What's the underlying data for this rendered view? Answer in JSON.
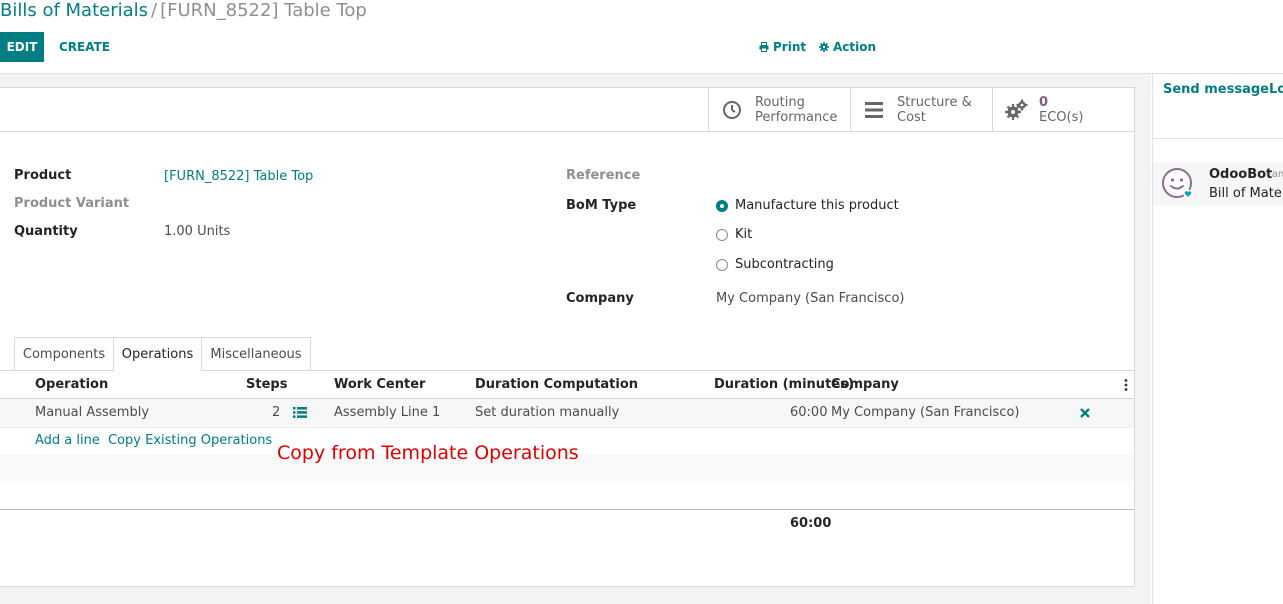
{
  "breadcrumb": {
    "parent": "Bills of Materials",
    "separator": "/",
    "current": "[FURN_8522] Table Top"
  },
  "toolbar": {
    "edit_label": "EDIT",
    "create_label": "CREATE",
    "print_label": "Print",
    "action_label": "Action"
  },
  "smart_buttons": {
    "routing": {
      "line1": "Routing",
      "line2": "Performance",
      "icon": "clock-icon"
    },
    "structure": {
      "line1": "Structure &",
      "line2": "Cost",
      "icon": "bars-icon"
    },
    "eco": {
      "count": "0",
      "label": "ECO(s)",
      "icon": "gears-icon"
    }
  },
  "form": {
    "product_label": "Product",
    "product_value": "[FURN_8522] Table Top",
    "variant_label": "Product Variant",
    "quantity_label": "Quantity",
    "quantity_value": "1.00",
    "quantity_uom": "Units",
    "reference_label": "Reference",
    "bom_type_label": "BoM Type",
    "bom_types": [
      "Manufacture this product",
      "Kit",
      "Subcontracting"
    ],
    "bom_type_selected": "Manufacture this product",
    "company_label": "Company",
    "company_value": "My Company (San Francisco)"
  },
  "tabs": [
    "Components",
    "Operations",
    "Miscellaneous"
  ],
  "active_tab": "Operations",
  "operations_table": {
    "columns": [
      "Operation",
      "Steps",
      "Work Center",
      "Duration Computation",
      "Duration (minutes)",
      "Company"
    ],
    "rows": [
      {
        "operation": "Manual Assembly",
        "steps": "2",
        "work_center": "Assembly Line 1",
        "duration_computation": "Set duration manually",
        "duration": "60:00",
        "company": "My Company (San Francisco)"
      }
    ],
    "add_line": "Add a line",
    "copy_existing": "Copy Existing Operations",
    "total": "60:00"
  },
  "annotation": "Copy from Template Operations",
  "chatter": {
    "send_message": "Send message",
    "log_note": "Lo",
    "message": {
      "author": "OdooBot",
      "time": "- an",
      "body": "Bill of Materia"
    }
  },
  "colors": {
    "accent": "#017e84",
    "eco": "#875a7b",
    "annotation": "#e00000"
  }
}
